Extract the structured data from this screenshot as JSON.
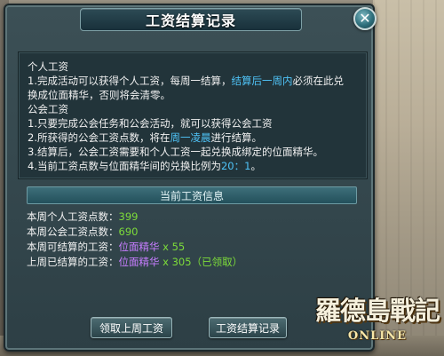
{
  "window": {
    "title": "工资结算记录",
    "close_glyph": "✕"
  },
  "rules": {
    "personal_heading": "个人工资",
    "personal_line1": "1.完成活动可以获得个人工资，每周一结算，",
    "personal_line1_highlight": "结算后一周内",
    "personal_line1_tail": "必须在此兑",
    "personal_line2": "换成位面精华，否则将会清零。",
    "guild_heading": "公会工资",
    "guild_line1": "1.只要完成公会任务和公会活动，就可以获得公会工资",
    "guild_line2_a": "2.所获得的公会工资点数，将在",
    "guild_line2_highlight": "周一凌晨",
    "guild_line2_b": "进行结算。",
    "guild_line3": "3.结算后，公会工资需要和个人工资一起兑换成绑定的位面精华。",
    "guild_line4_a": "4.当前工资点数与位面精华间的兑换比例为",
    "guild_line4_highlight": "20：1",
    "guild_line4_b": "。"
  },
  "current_info": {
    "section_title": "当前工资信息",
    "personal_label": "本周个人工资点数：",
    "personal_value": "399",
    "guild_label": "本周公会工资点数：",
    "guild_value": "690",
    "settle_label": "本周可结算的工资：",
    "settle_item": "位面精华",
    "settle_qty": " x 55",
    "last_label": "上周已结算的工资：",
    "last_item": "位面精华",
    "last_qty": " x 305（已领取）"
  },
  "buttons": {
    "claim_last_week": "领取上周工资",
    "settlement_record": "工资结算记录"
  },
  "logo": {
    "main": "羅德島戰記",
    "sub": "ONLINE"
  },
  "colors": {
    "highlight_blue": "#4fc3f7",
    "value_green": "#7ddc3a",
    "item_purple": "#c77dff"
  }
}
